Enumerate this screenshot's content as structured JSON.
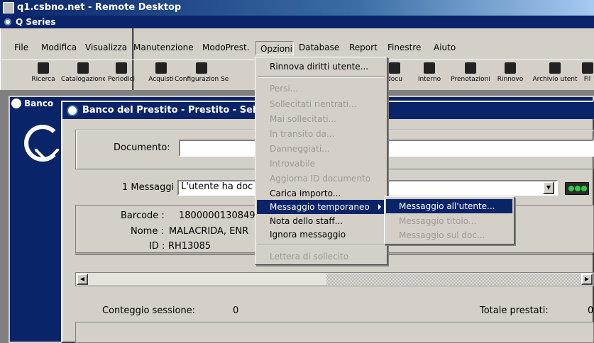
{
  "remote_desktop": {
    "title": "q1.csbno.net - Remote Desktop"
  },
  "app": {
    "title": "Q Series"
  },
  "menubar": {
    "items": [
      "File",
      "Modifica",
      "Visualizza",
      "Manutenzione",
      "ModoPrest.",
      "Opzioni",
      "Database",
      "Report",
      "Finestre",
      "Aiuto"
    ]
  },
  "toolbar": {
    "buttons": [
      "Ricerca",
      "Catalogazione",
      "Periodici",
      "Acquisti",
      "Configurazion Setup",
      "docu",
      "Interno",
      "Prenotazioni",
      "Rinnovo",
      "Archivio utent",
      "Fil"
    ]
  },
  "back_window": {
    "title": "Banco"
  },
  "window": {
    "title": "Banco del Prestito - Prestito - Selez",
    "documento_label": "Documento:",
    "documento_value": "",
    "messaggi_label": "1 Messaggi",
    "messaggi_value": "L'utente ha doc",
    "barcode_label": "Barcode :",
    "barcode_value": "1800000130849",
    "nome_label": "Nome :",
    "nome_value": "MALACRIDA, ENR",
    "id_label": "ID :",
    "id_value": "RH13085",
    "conteggio_label": "Conteggio sessione:",
    "conteggio_value": "0",
    "totale_label": "Totale prestati:",
    "totale_value": "0"
  },
  "opzioni_menu": {
    "items": [
      {
        "label": "Rinnova diritti utente...",
        "enabled": true
      },
      {
        "label": "Persi...",
        "enabled": false
      },
      {
        "label": "Sollecitati rientrati...",
        "enabled": false
      },
      {
        "label": "Mai sollecitati...",
        "enabled": false
      },
      {
        "label": "In transito da...",
        "enabled": false
      },
      {
        "label": "Danneggiati...",
        "enabled": false
      },
      {
        "label": "Introvabile",
        "enabled": false
      },
      {
        "label": "Aggiorna ID documento",
        "enabled": false
      },
      {
        "label": "Carica Importo...",
        "enabled": true
      },
      {
        "label": "Messaggio temporaneo",
        "enabled": true,
        "highlighted": true
      },
      {
        "label": "Nota dello staff...",
        "enabled": true
      },
      {
        "label": "Ignora messaggio",
        "enabled": true
      },
      {
        "label": "Lettera di sollecito",
        "enabled": false
      }
    ]
  },
  "submenu": {
    "items": [
      {
        "label": "Messaggio all'utente...",
        "enabled": true,
        "highlighted": true
      },
      {
        "label": "Messaggio titolo...",
        "enabled": false
      },
      {
        "label": "Messaggio sul doc...",
        "enabled": false
      }
    ]
  },
  "colors": {
    "title_bar": "#0a246a",
    "face": "#d4d0c8",
    "highlight": "#0a246a"
  }
}
